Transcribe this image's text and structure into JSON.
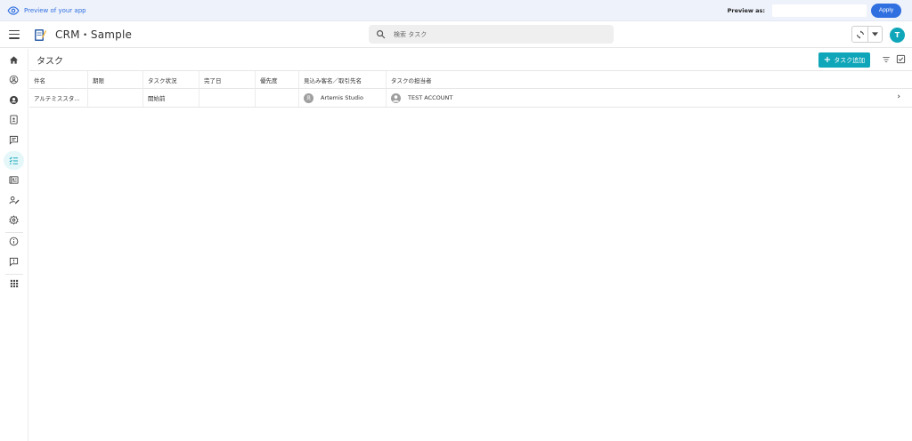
{
  "preview_bar": {
    "label": "Preview of your app",
    "preview_as_label": "Preview as:",
    "preview_as_value": "",
    "apply_label": "Apply"
  },
  "header": {
    "app_title": "CRM・Sample",
    "search_placeholder": "検索 タスク",
    "avatar_initial": "T"
  },
  "sidebar": {
    "items": [
      {
        "icon": "home-icon"
      },
      {
        "icon": "account-circle-icon"
      },
      {
        "icon": "person-icon"
      },
      {
        "icon": "contact-card-icon"
      },
      {
        "icon": "chat-icon"
      },
      {
        "icon": "task-list-icon",
        "active": true
      },
      {
        "icon": "newspaper-icon"
      },
      {
        "icon": "person-edit-icon"
      },
      {
        "icon": "settings-icon"
      },
      {
        "icon": "info-icon"
      },
      {
        "icon": "feedback-icon"
      },
      {
        "icon": "apps-grid-icon"
      }
    ]
  },
  "page": {
    "title": "タスク",
    "add_button_label": "タスク追加"
  },
  "table": {
    "columns": [
      "件名",
      "期限",
      "タスク状況",
      "完了日",
      "優先度",
      "見込み客名／取引先名",
      "タスクの担当者"
    ],
    "rows": [
      {
        "subject": "アルテミススタ...",
        "due": "",
        "status": "開始前",
        "completed": "",
        "priority": "",
        "account_initial": "見",
        "account": "Artemis Studio",
        "owner": "TEST ACCOUNT"
      }
    ]
  },
  "colors": {
    "accent": "#10a6b9",
    "preview_blue": "#2f6fe0",
    "preview_bg": "#eef2fb"
  }
}
